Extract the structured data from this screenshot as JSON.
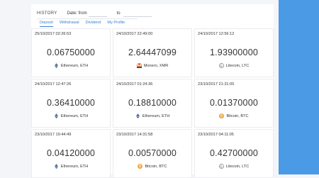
{
  "history": {
    "title": "HISTORY",
    "date_from_label": "Date: from",
    "date_to_label": "to"
  },
  "tabs": [
    {
      "label": "Deposit",
      "active": true
    },
    {
      "label": "Withdrawal",
      "active": false
    },
    {
      "label": "Dividend",
      "active": false
    },
    {
      "label": "My Profile",
      "active": false
    }
  ],
  "colors": {
    "accent": "#3b7fd0",
    "sidebar": "#4a9ae6",
    "bitcoin": "#f2a33a",
    "monero": "#f26822"
  },
  "cards": [
    {
      "date": "25/10/2017 02:26:53",
      "amount": "0.06750000",
      "coin": "Ethereum, ETH",
      "icon": "ethereum-icon"
    },
    {
      "date": "24/10/2017 22:49:00",
      "amount": "2.64447099",
      "coin": "Monero, XMR",
      "icon": "monero-icon"
    },
    {
      "date": "24/10/2017 12:56:12",
      "amount": "1.93900000",
      "coin": "Litecoin, LTC",
      "icon": "litecoin-icon"
    },
    {
      "date": "24/10/2017 12:47:26",
      "amount": "0.36410000",
      "coin": "Ethereum, ETH",
      "icon": "ethereum-icon"
    },
    {
      "date": "24/10/2017 01:24:36",
      "amount": "0.18810000",
      "coin": "Ethereum, ETH",
      "icon": "ethereum-icon"
    },
    {
      "date": "23/10/2017 21:31:05",
      "amount": "0.01370000",
      "coin": "Bitcoin, BTC",
      "icon": "bitcoin-icon"
    },
    {
      "date": "23/10/2017 19:44:49",
      "amount": "0.04120000",
      "coin": "Ethereum, ETH",
      "icon": "ethereum-icon"
    },
    {
      "date": "23/10/2017 14:31:58",
      "amount": "0.00570000",
      "coin": "Bitcoin, BTC",
      "icon": "bitcoin-icon"
    },
    {
      "date": "23/10/2017 04:11:05",
      "amount": "0.42700000",
      "coin": "Litecoin, LTC",
      "icon": "litecoin-icon"
    }
  ]
}
